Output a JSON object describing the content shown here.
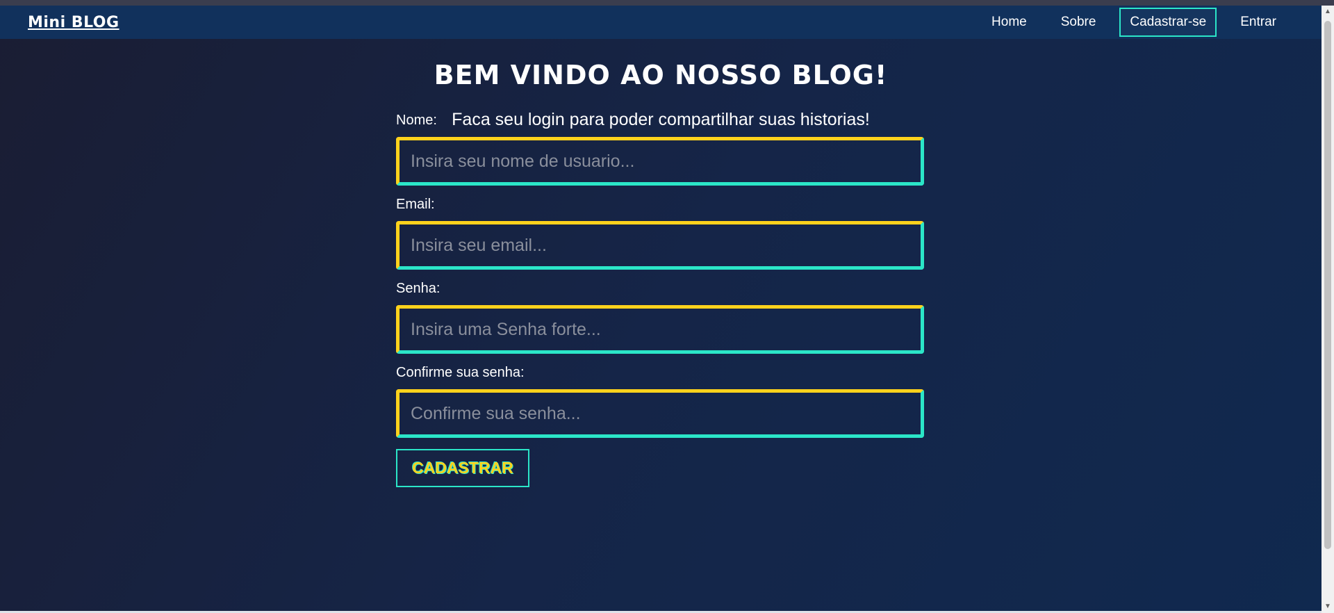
{
  "nav": {
    "brand": "Mini BLOG",
    "links": [
      "Home",
      "Sobre",
      "Cadastrar-se",
      "Entrar"
    ]
  },
  "page": {
    "title": "BEM VINDO AO NOSSO BLOG!",
    "subtitle": "Faca seu login para poder compartilhar suas historias!"
  },
  "form": {
    "fields": [
      {
        "label": "Nome:",
        "placeholder": "Insira seu nome de usuario..."
      },
      {
        "label": "Email:",
        "placeholder": "Insira seu email..."
      },
      {
        "label": "Senha:",
        "placeholder": "Insira uma Senha forte..."
      },
      {
        "label": "Confirme sua senha:",
        "placeholder": "Confirme sua senha..."
      }
    ],
    "submit_label": "CADASTRAR"
  },
  "colors": {
    "accent_yellow": "#ffd21c",
    "accent_cyan": "#2be6c8",
    "navbar": "#11315c"
  }
}
